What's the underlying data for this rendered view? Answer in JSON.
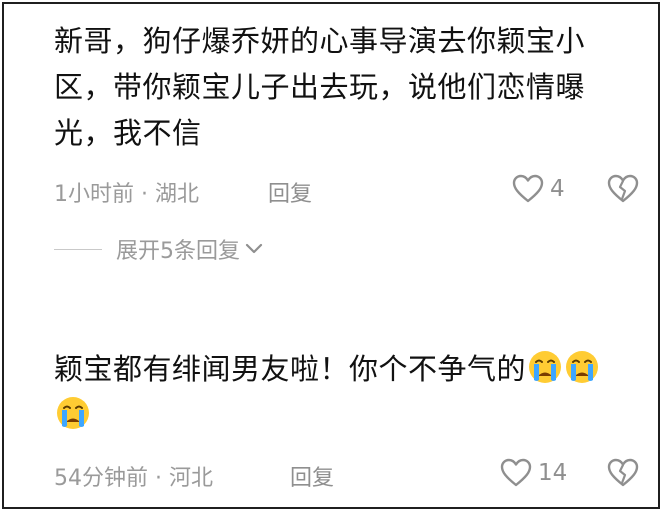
{
  "comments": [
    {
      "text": "新哥，狗仔爆乔妍的心事导演去你颖宝小区，带你颖宝儿子出去玩，说他们恋情曝光，我不信",
      "time_location": "1小时前 · 湖北",
      "reply_label": "回复",
      "likes": "4"
    },
    {
      "text": "颖宝都有绯闻男友啦！你个不争气的",
      "emojis": [
        "crying-face",
        "crying-face",
        "crying-face"
      ],
      "time_location": "54分钟前 · 河北",
      "reply_label": "回复",
      "likes": "14"
    }
  ],
  "expand_replies": {
    "label": "展开5条回复"
  },
  "icons": {
    "like": "heart-outline-icon",
    "dislike": "broken-heart-icon",
    "expand": "chevron-down-icon"
  },
  "colors": {
    "text": "#111111",
    "meta": "#9a9a9a",
    "emoji_face": "#ffcc33",
    "emoji_tears": "#3ea6ff"
  }
}
